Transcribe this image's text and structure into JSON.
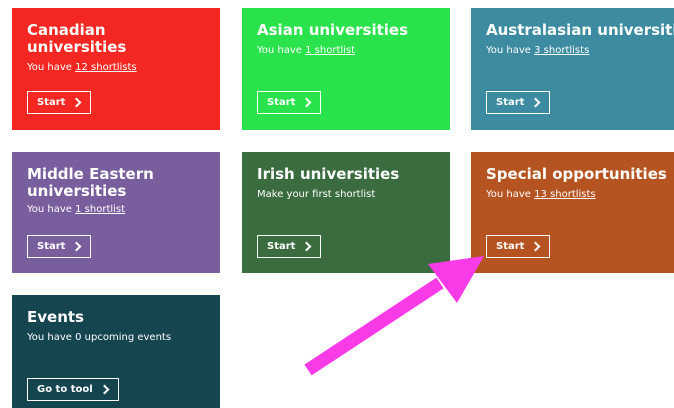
{
  "cards": [
    {
      "title": "Canadian universities",
      "prefix": "You have ",
      "link": "12 shortlists",
      "button": "Start",
      "color": "#f52722"
    },
    {
      "title": "Asian universities",
      "prefix": "You have ",
      "link": "1 shortlist",
      "button": "Start",
      "color": "#2ae24c"
    },
    {
      "title": "Australasian universities",
      "prefix": "You have ",
      "link": "3 shortlists",
      "button": "Start",
      "color": "#3d8ba0"
    },
    {
      "title": "Middle Eastern universities",
      "prefix": "You have ",
      "link": "1 shortlist",
      "button": "Start",
      "color": "#795e9e"
    },
    {
      "title": "Irish universities",
      "prefix": "Make your first shortlist",
      "link": "",
      "button": "Start",
      "color": "#3b6c3f"
    },
    {
      "title": "Special opportunities",
      "prefix": "You have ",
      "link": "13 shortlists",
      "button": "Start",
      "color": "#b65421"
    },
    {
      "title": "Events",
      "prefix": "You have 0 upcoming events",
      "link": "",
      "button": "Go to tool",
      "color": "#15454f"
    }
  ],
  "annotation": {
    "arrow_color": "#f83be6"
  }
}
